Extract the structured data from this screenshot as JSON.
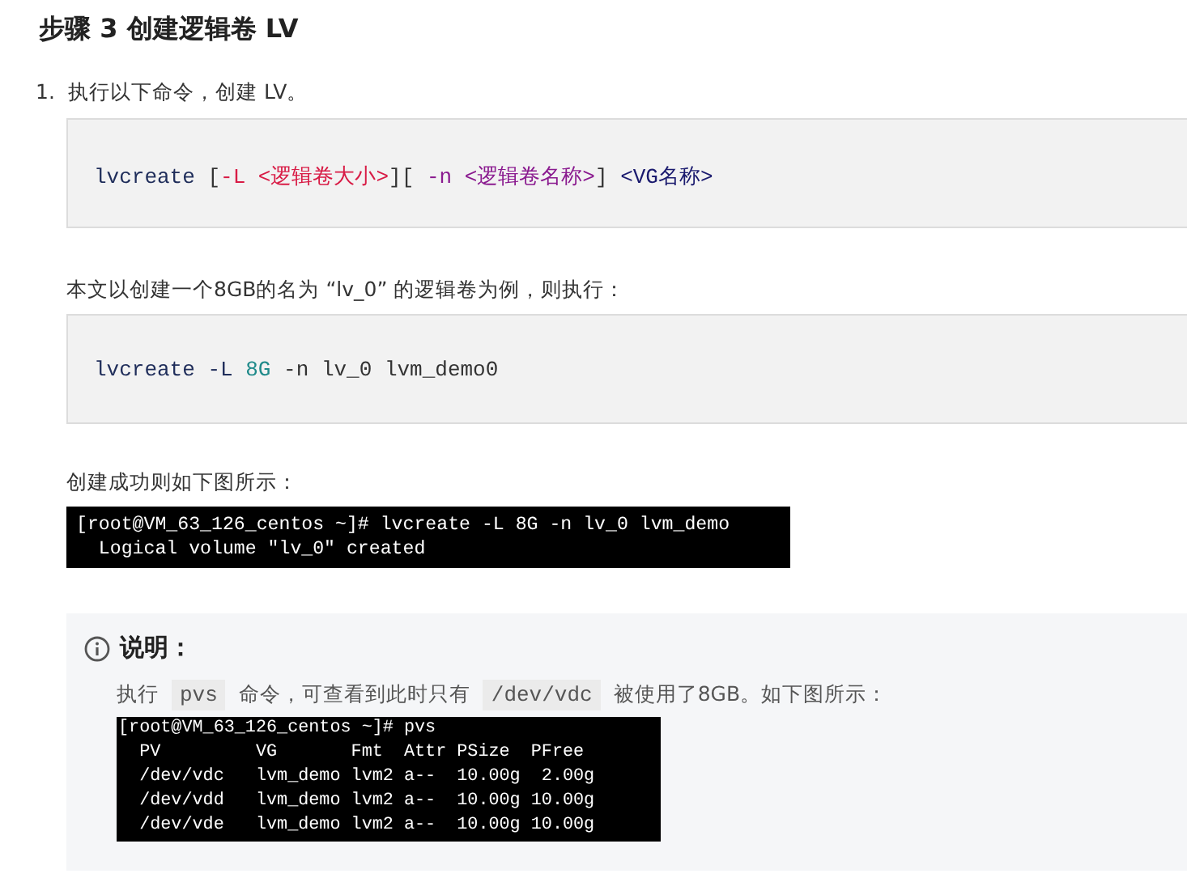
{
  "heading": "步骤 3 创建逻辑卷 LV",
  "steps": [
    {
      "number": "1.",
      "text": "执行以下命令，创建 LV。"
    }
  ],
  "code_blocks": [
    {
      "tokens": [
        {
          "kind": "plain",
          "text": "lvcreate "
        },
        {
          "kind": "bracket",
          "text": "["
        },
        {
          "kind": "option",
          "text": "-L <逻辑卷大小>"
        },
        {
          "kind": "bracket",
          "text": "]["
        },
        {
          "kind": "name",
          "text": " -n <逻辑卷名称>"
        },
        {
          "kind": "bracket",
          "text": "] "
        },
        {
          "kind": "arg",
          "text": "<VG名称>"
        }
      ]
    },
    {
      "intro": "本文以创建一个8GB的名为 “lv_0” 的逻辑卷为例，则执行：",
      "tokens": [
        {
          "kind": "plain",
          "text": "lvcreate -L "
        },
        {
          "kind": "number",
          "text": "8G"
        },
        {
          "kind": "bracket",
          "text": " -n lv_0 lvm_demo0"
        }
      ]
    }
  ],
  "result_caption": "创建成功则如下图所示：",
  "terminal_1": [
    "[root@VM_63_126_centos ~]# lvcreate -L 8G -n lv_0 lvm_demo",
    "  Logical volume \"lv_0\" created"
  ],
  "note": {
    "title": "说明：",
    "segments": [
      {
        "kind": "text",
        "text": "执行"
      },
      {
        "kind": "code",
        "text": "pvs"
      },
      {
        "kind": "text",
        "text": "命令，可查看到此时只有"
      },
      {
        "kind": "code",
        "text": "/dev/vdc"
      },
      {
        "kind": "text",
        "text": "被使用了8GB。如下图所示："
      }
    ],
    "terminal": [
      "[root@VM_63_126_centos ~]# pvs",
      "  PV         VG       Fmt  Attr PSize  PFree ",
      "  /dev/vdc   lvm_demo lvm2 a--  10.00g  2.00g",
      "  /dev/vdd   lvm_demo lvm2 a--  10.00g 10.00g",
      "  /dev/vde   lvm_demo lvm2 a--  10.00g 10.00g"
    ]
  }
}
